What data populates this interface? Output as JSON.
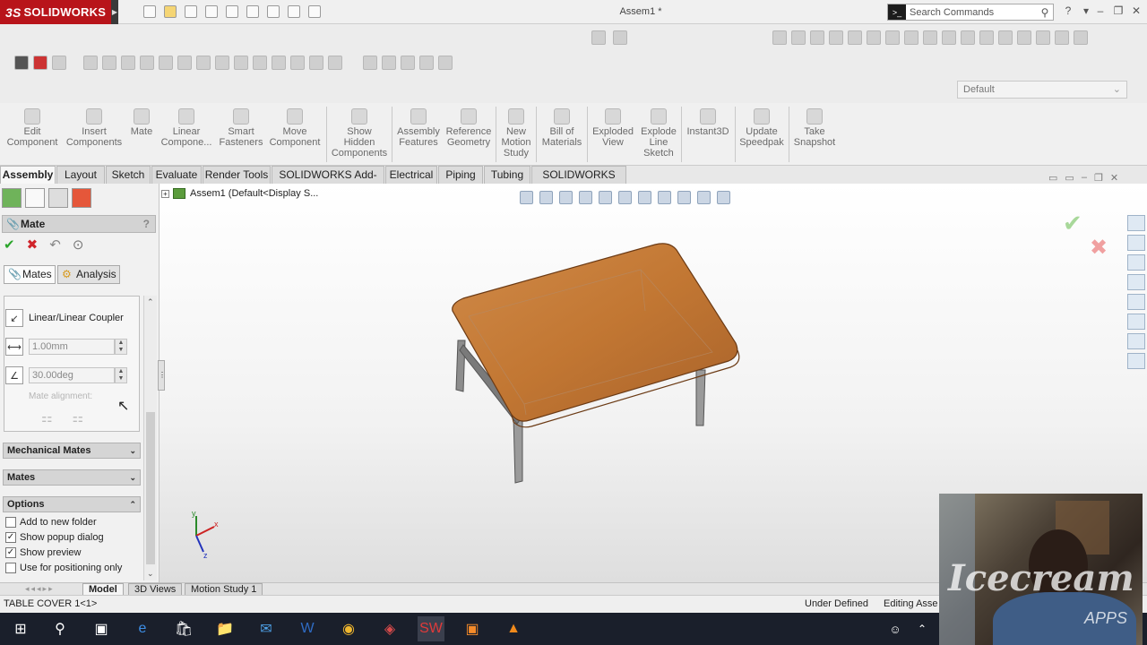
{
  "app": {
    "name": "SOLIDWORKS",
    "ds": "3S",
    "title": "Assem1 *"
  },
  "search": {
    "placeholder": "Search Commands"
  },
  "config_dropdown": {
    "value": "Default"
  },
  "command_manager": [
    {
      "label": "Edit\nComponent",
      "icon": "edit-component-icon"
    },
    {
      "label": "Insert\nComponents",
      "icon": "insert-components-icon"
    },
    {
      "label": "Mate",
      "icon": "mate-icon"
    },
    {
      "label": "Linear\nCompone...",
      "icon": "linear-pattern-icon"
    },
    {
      "label": "Smart\nFasteners",
      "icon": "smart-fasteners-icon"
    },
    {
      "label": "Move\nComponent",
      "icon": "move-component-icon"
    },
    {
      "label": "Show\nHidden\nComponents",
      "icon": "show-hidden-icon"
    },
    {
      "label": "Assembly\nFeatures",
      "icon": "assembly-features-icon"
    },
    {
      "label": "Reference\nGeometry",
      "icon": "reference-geometry-icon"
    },
    {
      "label": "New\nMotion\nStudy",
      "icon": "motion-study-icon"
    },
    {
      "label": "Bill of\nMaterials",
      "icon": "bom-icon"
    },
    {
      "label": "Exploded\nView",
      "icon": "exploded-view-icon"
    },
    {
      "label": "Explode\nLine\nSketch",
      "icon": "explode-line-icon"
    },
    {
      "label": "Instant3D",
      "icon": "instant3d-icon"
    },
    {
      "label": "Update\nSpeedpak",
      "icon": "speedpak-icon"
    },
    {
      "label": "Take\nSnapshot",
      "icon": "snapshot-icon"
    }
  ],
  "tabs": [
    "Assembly",
    "Layout",
    "Sketch",
    "Evaluate",
    "Render Tools",
    "SOLIDWORKS Add-Ins",
    "Electrical",
    "Piping",
    "Tubing",
    "SOLIDWORKS MBD"
  ],
  "property_manager": {
    "title": "Mate",
    "help": "?",
    "subtabs": [
      "Mates",
      "Analysis"
    ],
    "coupler_label": "Linear/Linear Coupler",
    "distance_value": "1.00mm",
    "angle_value": "30.00deg",
    "mate_alignment": "Mate alignment:",
    "groups": {
      "mechanical": "Mechanical Mates",
      "mates": "Mates",
      "options": "Options"
    },
    "options": [
      {
        "label": "Add to new folder",
        "checked": false
      },
      {
        "label": "Show popup dialog",
        "checked": true
      },
      {
        "label": "Show preview",
        "checked": true
      },
      {
        "label": "Use for positioning only",
        "checked": false
      }
    ]
  },
  "tree": {
    "label": "Assem1  (Default<Display S..."
  },
  "bottom_tabs": [
    "Model",
    "3D Views",
    "Motion Study 1"
  ],
  "status": {
    "left": "TABLE COVER 1<1>",
    "state": "Under Defined",
    "editing": "Editing Asse"
  },
  "watermark": {
    "main": "Icecream",
    "sub": "APPS"
  }
}
